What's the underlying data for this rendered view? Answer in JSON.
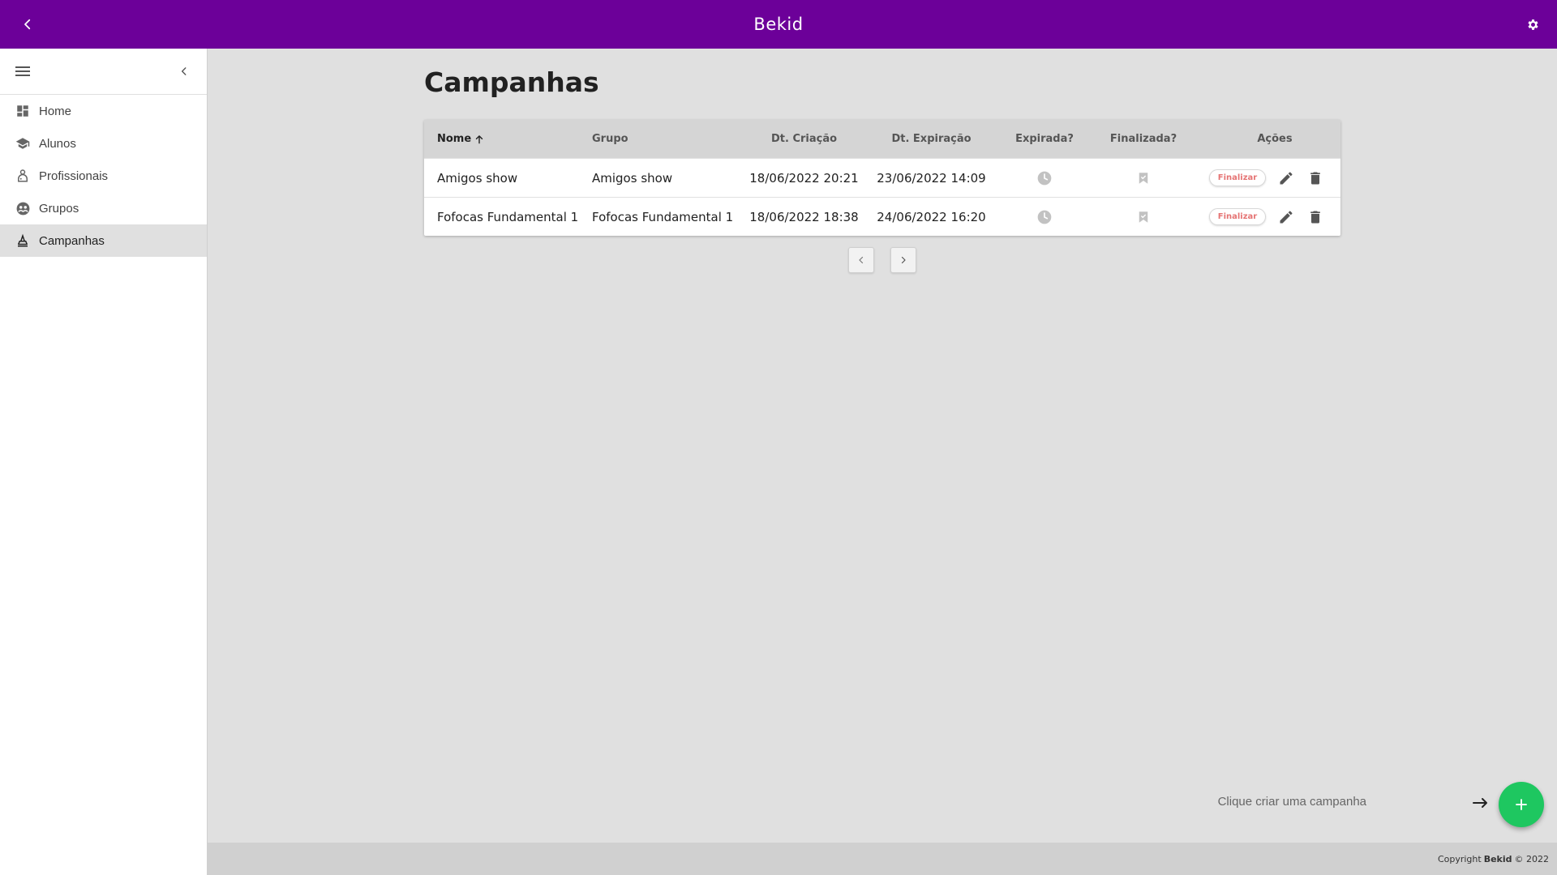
{
  "app": {
    "title": "Bekid",
    "accent": "#6c0099",
    "fab_color": "#1ec760"
  },
  "sidebar": {
    "items": [
      {
        "label": "Home",
        "icon": "dashboard-icon"
      },
      {
        "label": "Alunos",
        "icon": "graduation-cap-icon"
      },
      {
        "label": "Profissionais",
        "icon": "professional-icon"
      },
      {
        "label": "Grupos",
        "icon": "groups-icon"
      },
      {
        "label": "Campanhas",
        "icon": "campaign-icon",
        "active": true
      }
    ]
  },
  "main": {
    "title": "Campanhas",
    "table": {
      "headers": {
        "nome": "Nome",
        "grupo": "Grupo",
        "dt_criacao": "Dt. Criação",
        "dt_expiracao": "Dt. Expiração",
        "expirada": "Expirada?",
        "finalizada": "Finalizada?",
        "acoes": "Ações"
      },
      "sort": {
        "column": "Nome",
        "direction": "ascending"
      },
      "rows": [
        {
          "nome": "Amigos show",
          "grupo": "Amigos show",
          "dt_criacao": "18/06/2022 20:21",
          "dt_expiracao": "23/06/2022 14:09",
          "finalizar_label": "Finalizar"
        },
        {
          "nome": "Fofocas Fundamental 1",
          "grupo": "Fofocas Fundamental 1",
          "dt_criacao": "18/06/2022 18:38",
          "dt_expiracao": "24/06/2022 16:20",
          "finalizar_label": "Finalizar"
        }
      ]
    },
    "fab_hint": "Clique criar uma campanha"
  },
  "footer": {
    "prefix": "Copyright",
    "brand": "Bekid",
    "suffix": "© 2022"
  }
}
